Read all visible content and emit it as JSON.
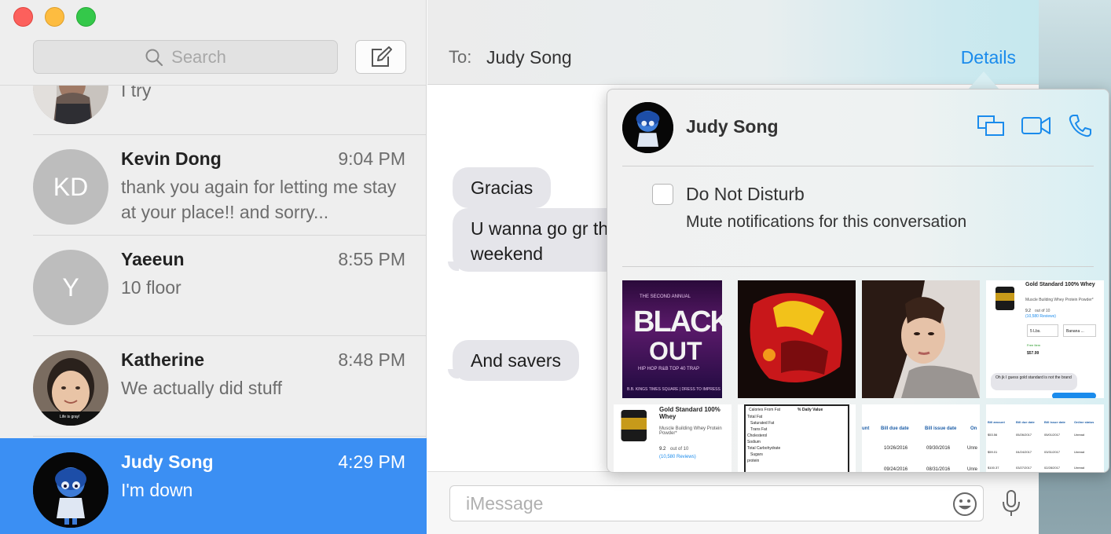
{
  "search": {
    "placeholder": "Search"
  },
  "conversations": [
    {
      "name": "",
      "time": "",
      "preview": "I try",
      "avatar": "photo"
    },
    {
      "name": "Kevin Dong",
      "time": "9:04 PM",
      "preview": "thank you again for letting me stay at your place!! and sorry...",
      "initials": "KD"
    },
    {
      "name": "Yaeeun",
      "time": "8:55 PM",
      "preview": "10 floor",
      "initials": "Y"
    },
    {
      "name": "Katherine",
      "time": "8:48 PM",
      "preview": "We actually did stuff",
      "avatar_caption": "Life is gray!"
    },
    {
      "name": "Judy Song",
      "time": "4:29 PM",
      "preview": "I'm down",
      "selected": true
    }
  ],
  "header": {
    "to_label": "To:",
    "recipient": "Judy Song",
    "details_label": "Details"
  },
  "messages": [
    {
      "text": "Gracias"
    },
    {
      "text": "U wanna go gr this weekend"
    },
    {
      "text": "And savers"
    }
  ],
  "composer": {
    "placeholder": "iMessage"
  },
  "details": {
    "name": "Judy Song",
    "dnd_label": "Do Not Disturb",
    "dnd_description": "Mute notifications for this conversation",
    "attachments": {
      "blackout": {
        "top": "THE SECOND ANNUAL",
        "title1": "BLACK",
        "title2": "OUT",
        "sub": "HIP HOP R&B TOP 40 TRAP",
        "footer": "B.B. KINGS TIMES SQUARE | DRESS TO IMPRESS"
      },
      "whey_screenshot": {
        "title": "Gold Standard 100% Whey",
        "subtitle": "Muscle Building Whey Protein Powder*",
        "rating": "9.2",
        "rating_suffix": "out of 10",
        "reviews": "(10,580 Reviews)",
        "size": "5 Lbs.",
        "flavor": "Banana ...",
        "free_item": "Free Item",
        "price": "$57.99",
        "chat": "Oh jk I guess gold standard is not the brand"
      },
      "nutrition": {
        "rows": [
          "Calories From Fat",
          "Total Fat",
          "Saturated Fat",
          "Trans Fat",
          "Cholesterol",
          "Sodium",
          "Total Carbohydrate",
          "Sugars",
          "protein"
        ],
        "header": "% Daily Value"
      },
      "bills": {
        "headers": [
          "unt",
          "Bill due date",
          "Bill issue date",
          "On"
        ],
        "rows": [
          [
            "10/26/2016",
            "09/30/2016",
            "Unre"
          ],
          [
            "09/24/2016",
            "08/31/2016",
            "Unre"
          ]
        ]
      },
      "bills2": {
        "headers": [
          "Bill amount",
          "Bill due date",
          "Bill issue date",
          "Online status"
        ],
        "rows": [
          [
            "$53.56",
            "05/26/2017",
            "05/01/2017",
            "Unread"
          ],
          [
            "$59.01",
            "04/24/2017",
            "03/31/2017",
            "Unread"
          ],
          [
            "$100.37",
            "03/27/2017",
            "02/28/2017",
            "Unread"
          ]
        ]
      }
    }
  },
  "colors": {
    "selected_row": "#3b8ff3",
    "accent": "#1a8bec",
    "bubble": "#e5e5ea"
  },
  "icons": [
    "search-icon",
    "compose-icon",
    "screen-share-icon",
    "video-icon",
    "phone-icon",
    "emoji-icon",
    "microphone-icon"
  ]
}
